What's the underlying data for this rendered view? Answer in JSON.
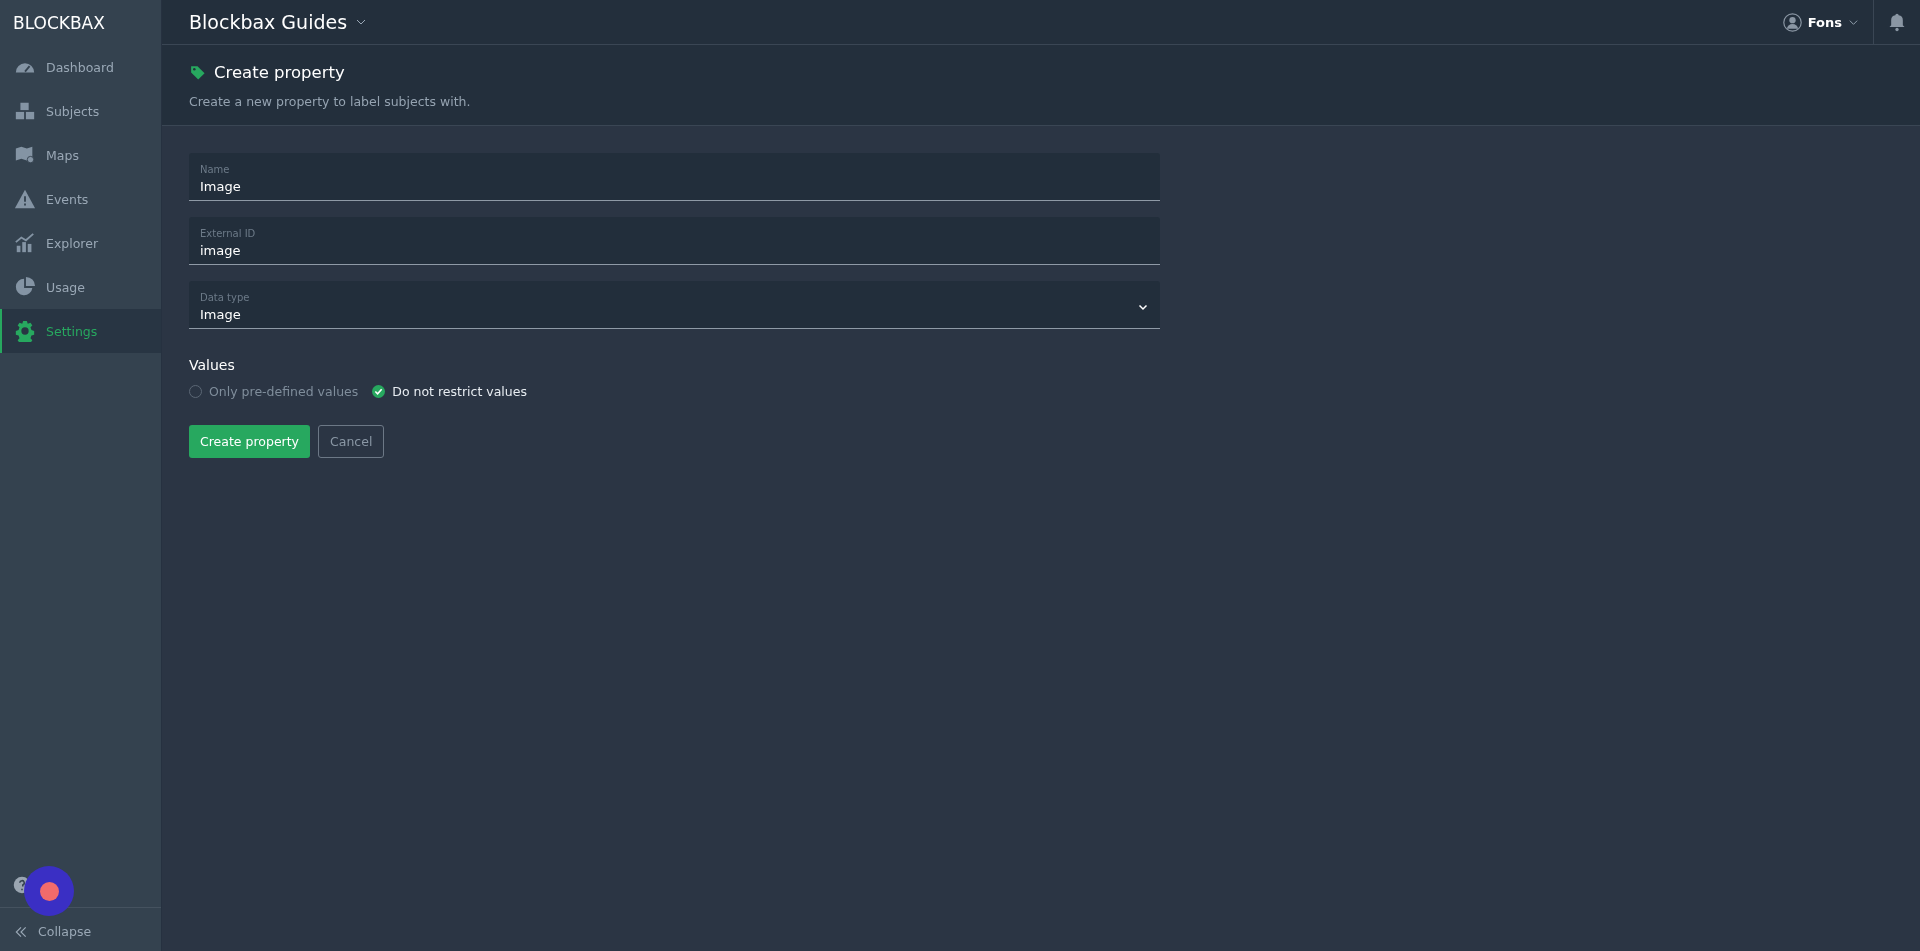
{
  "sidebar": {
    "logo": "BLOCKBAX",
    "items": [
      {
        "label": "Dashboard",
        "selected": false
      },
      {
        "label": "Subjects",
        "selected": false
      },
      {
        "label": "Maps",
        "selected": false
      },
      {
        "label": "Events",
        "selected": false
      },
      {
        "label": "Explorer",
        "selected": false
      },
      {
        "label": "Usage",
        "selected": false
      },
      {
        "label": "Settings",
        "selected": true
      }
    ],
    "collapse": "Collapse"
  },
  "topbar": {
    "project": "Blockbax Guides",
    "user": "Fons"
  },
  "page_header": {
    "title": "Create property",
    "subtitle": "Create a new property to label subjects with."
  },
  "form": {
    "fields": [
      {
        "kind": "text",
        "label": "Name",
        "value": "Image"
      },
      {
        "kind": "text",
        "label": "External ID",
        "value": "image"
      },
      {
        "kind": "select",
        "label": "Data type",
        "value": "Image"
      }
    ],
    "values": {
      "label": "Values",
      "options": [
        {
          "label": "Only pre-defined values",
          "selected": false
        },
        {
          "label": "Do not restrict values",
          "selected": true
        }
      ]
    },
    "buttons": [
      {
        "kind": "primary",
        "label": "Create property"
      },
      {
        "kind": "secondary",
        "label": "Cancel"
      }
    ]
  }
}
